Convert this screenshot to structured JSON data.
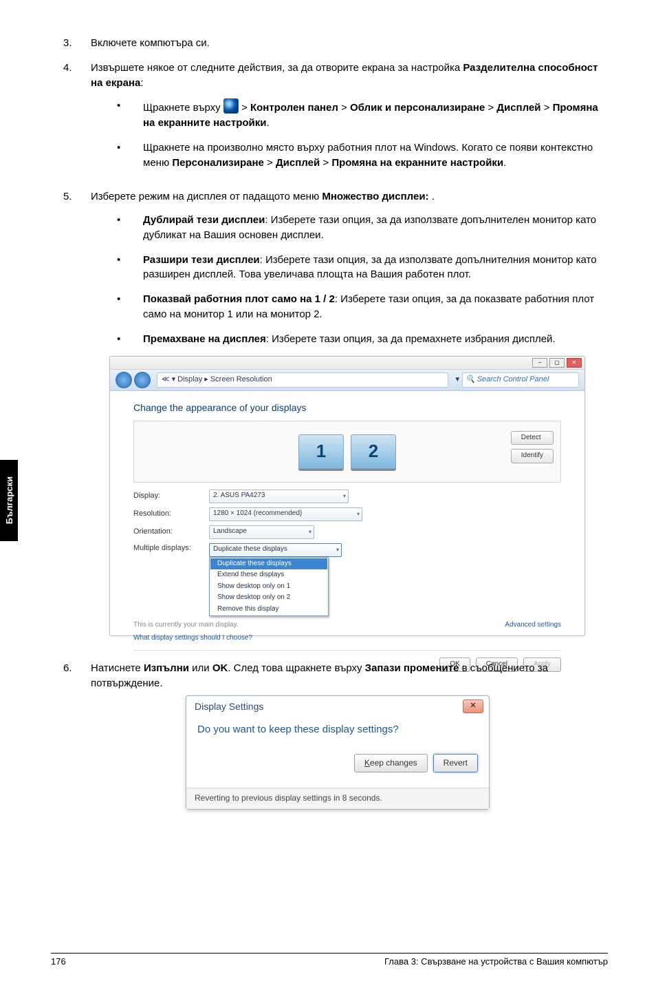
{
  "sideTab": "Български",
  "steps": {
    "s3": {
      "num": "3.",
      "text": "Включете компютъра си."
    },
    "s4": {
      "num": "4.",
      "intro_a": "Извършете някое от следните действия, за да отворите екрана за настройка ",
      "intro_b": "Разделителна способност на екрана",
      "intro_c": ":",
      "b1_a": "Щракнете върху ",
      "b1_b": " > ",
      "b1_c": "Контролен панел",
      "b1_d": " > ",
      "b1_e": "Облик и персонализиране",
      "b1_f": " > ",
      "b1_g": "Дисплей",
      "b1_h": " > ",
      "b1_i": "Промяна на екранните настройки",
      "b1_j": ".",
      "b2_a": "Щракнете на произволно място върху работния плот на Windows. Когато се появи контекстно меню  ",
      "b2_b": "Персонализиране",
      "b2_c": " > ",
      "b2_d": "Дисплей",
      "b2_e": " > ",
      "b2_f": "Промяна на екранните настройки",
      "b2_g": "."
    },
    "s5": {
      "num": "5.",
      "intro_a": "Изберете режим на дисплея от падащото меню ",
      "intro_b": "Множество дисплеи:",
      "intro_c": " .",
      "i1_t": "Дублирай тези дисплеи",
      "i1_r": ": Изберете тази опция, за да използвате допълнителен монитор като дубликат на Вашия основен дисплеи.",
      "i2_t": "Разшири тези дисплеи",
      "i2_r": ": Изберете тази опция, за да използвате допълнителния монитор като разширен дисплей. Това увеличава площта на Вашия работен плот.",
      "i3_t": "Показвай работния плот само на 1 / 2",
      "i3_r": ": Изберете тази опция, за да показвате работния плот само на монитор 1 или на монитор 2.",
      "i4_t": "Премахване на дисплея",
      "i4_r": ": Изберете тази опция, за да премахнете избрания дисплей."
    },
    "s6": {
      "num": "6.",
      "a": "Натиснете ",
      "b": "Изпълни",
      "c": " или ",
      "d": "OK",
      "e": ". След това щракнете върху ",
      "f": "Запази промените",
      "g": " в съобщението за потвърждение."
    }
  },
  "fig1": {
    "breadcrumb": "≪ ▾ Display ▸ Screen Resolution",
    "searchPlaceholder": "Search Control Panel",
    "heading": "Change the appearance of your displays",
    "detect": "Detect",
    "identify": "Identify",
    "mon1": "1",
    "mon2": "2",
    "rows": {
      "display": {
        "label": "Display:",
        "value": "2. ASUS PA4273"
      },
      "resolution": {
        "label": "Resolution:",
        "value": "1280 × 1024 (recommended)"
      },
      "orientation": {
        "label": "Orientation:",
        "value": "Landscape"
      },
      "multi": {
        "label": "Multiple displays:"
      }
    },
    "dropdown": {
      "opt_sel": "Duplicate these displays",
      "opt2": "Duplicate these displays",
      "opt3": "Extend these displays",
      "opt4": "Show desktop only on 1",
      "opt5": "Show desktop only on 2",
      "opt6": "Remove this display"
    },
    "mainNote": "This is currently your main display.",
    "advanced": "Advanced settings",
    "whatNote": "What display settings should I choose?",
    "ok": "OK",
    "cancel": "Cancel",
    "apply": "Apply"
  },
  "fig2": {
    "title": "Display Settings",
    "question": "Do you want to keep these display settings?",
    "keep_pre": "K",
    "keep_rest": "eep changes",
    "revert": "Revert",
    "status": "Reverting to previous display settings in 8 seconds."
  },
  "footer": {
    "page": "176",
    "chapter": "Глава 3: Свързване на устройства с Вашия компютър"
  }
}
